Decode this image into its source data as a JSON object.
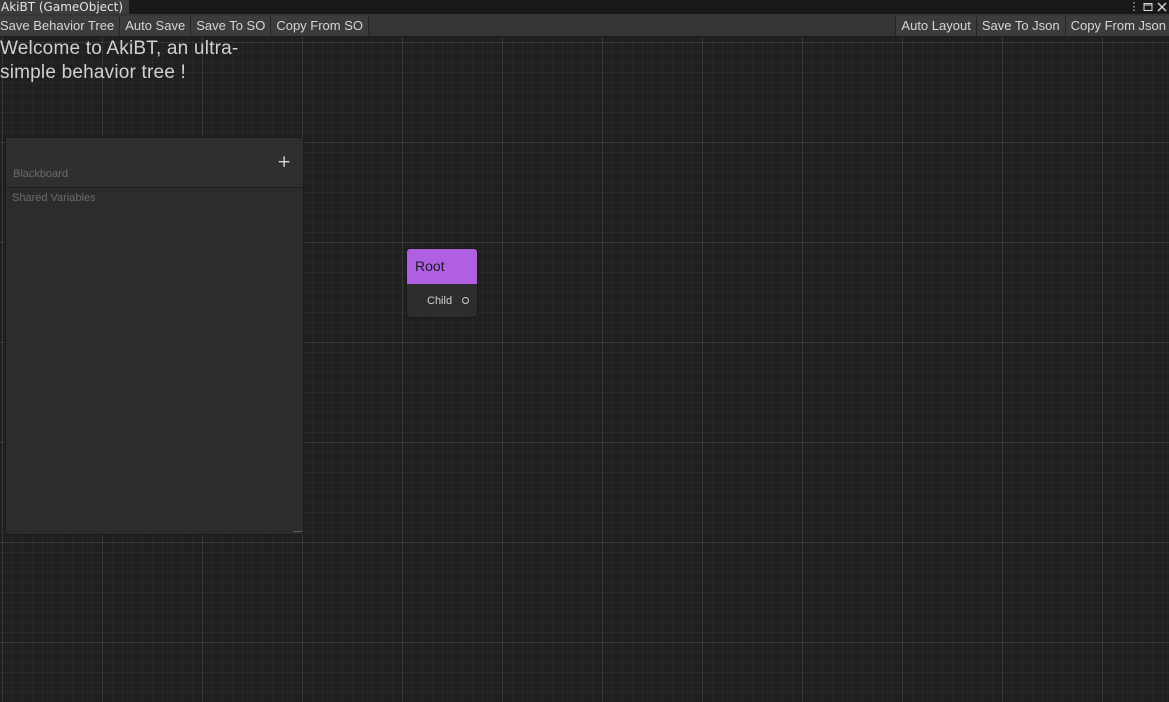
{
  "window": {
    "tab_title": "AkiBT (GameObject)",
    "controls": {
      "menu_icon": "kebab-menu-icon",
      "maximize_icon": "maximize-icon",
      "close_icon": "close-icon"
    }
  },
  "toolbar": {
    "left": [
      "Save Behavior Tree",
      "Auto Save",
      "Save To SO",
      "Copy From SO"
    ],
    "right": [
      "Auto Layout",
      "Save To Json",
      "Copy From Json"
    ]
  },
  "canvas": {
    "welcome_line1": "Welcome to AkiBT, an ultra-",
    "welcome_line2": "simple behavior tree !"
  },
  "blackboard": {
    "title": "Blackboard",
    "subtitle": "Shared Variables",
    "add_icon": "plus-icon"
  },
  "root_node": {
    "title": "Root",
    "port_label": "Child",
    "header_color": "#b05fe3"
  }
}
